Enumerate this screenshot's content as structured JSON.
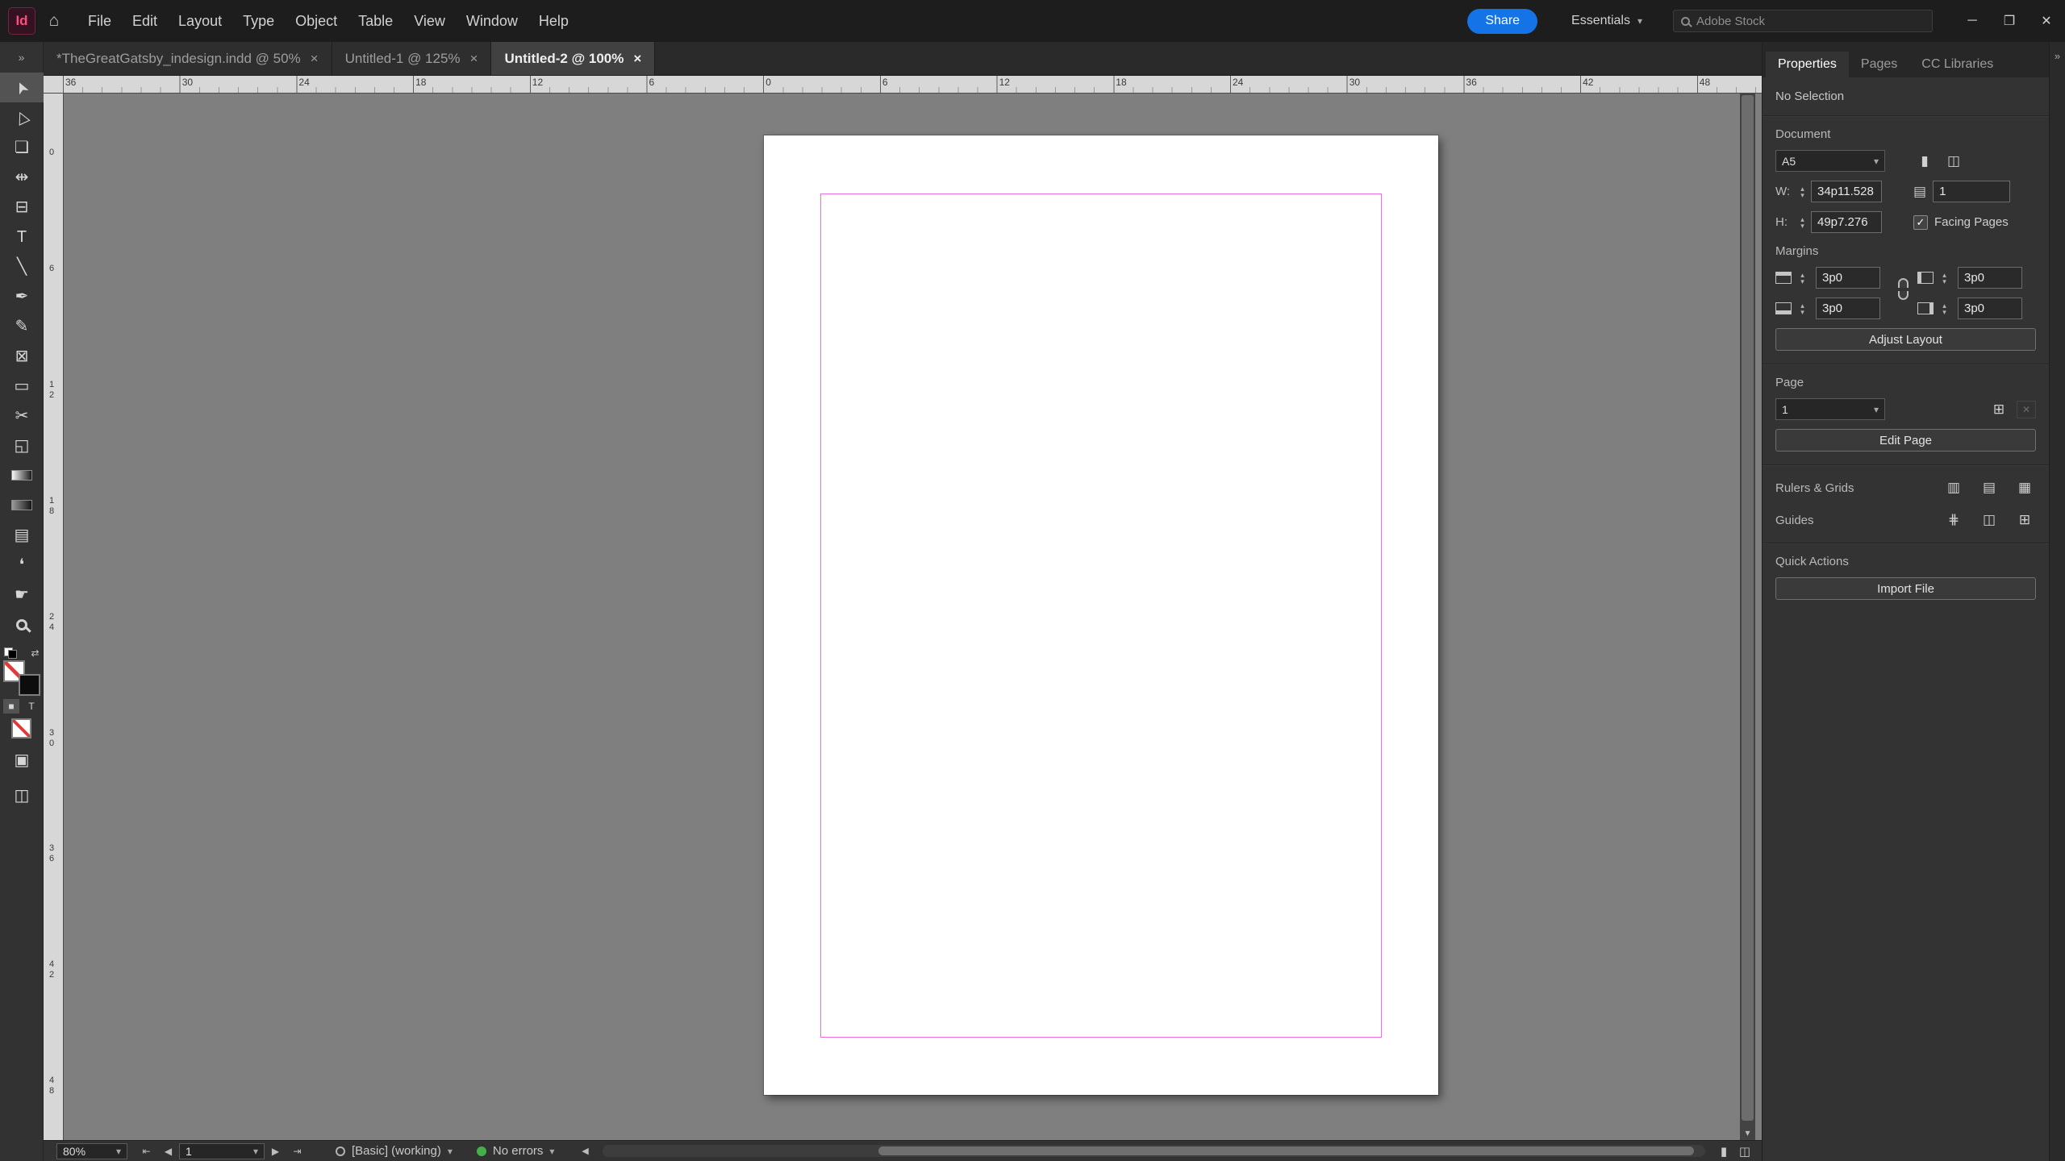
{
  "colors": {
    "accent_blue": "#1473e6",
    "margin_guide": "#ee6be9",
    "no_errors_green": "#44b04a",
    "logo_pink": "#ff4c7f",
    "canvas_gray": "#7f7f7f"
  },
  "ui": {
    "icons": {
      "home": "⌂",
      "collapse_left": "»",
      "collapse_right": "»",
      "chevron_down": "▾",
      "chevron_up": "▴",
      "close": "×",
      "minimize": "─",
      "restore": "❐",
      "close_window": "✕",
      "nav_first": "⇤",
      "nav_prev": "◀",
      "nav_next": "▶",
      "nav_last": "⇥",
      "swap": "⇄",
      "fmt_container": "■",
      "fmt_text": "T",
      "view_normal": "▣",
      "screen_mode": "◫",
      "doc_portrait": "▮",
      "doc_landscape": "◫",
      "pages_book": "▤",
      "add_page": "⊞",
      "delete_page": "✕",
      "ruler_icon": "▥",
      "baseline_grid_icon": "▤",
      "document_grid_icon": "▦",
      "guides_icon": "⋕",
      "column_guides_icon": "◫",
      "smart_guides_icon": "⊞",
      "check": "✓"
    }
  },
  "titlebar": {
    "logo": "Id",
    "menus": [
      "File",
      "Edit",
      "Layout",
      "Type",
      "Object",
      "Table",
      "View",
      "Window",
      "Help"
    ],
    "share_label": "Share",
    "workspace_label": "Essentials",
    "stock_placeholder": "Adobe Stock"
  },
  "tabs": [
    {
      "label": "*TheGreatGatsby_indesign.indd @ 50%"
    },
    {
      "label": "Untitled-1 @ 125%"
    },
    {
      "label": "Untitled-2 @ 100%",
      "active": true
    }
  ],
  "rulers": {
    "horizontal": [
      "36",
      "30",
      "24",
      "18",
      "12",
      "6",
      "0",
      "6",
      "12",
      "18",
      "24",
      "30",
      "36",
      "42",
      "48"
    ],
    "vertical": [
      "0",
      "6",
      "12",
      "18",
      "24",
      "30",
      "36",
      "42",
      "48"
    ]
  },
  "toolbar": {
    "tools": [
      {
        "name": "selection-tool",
        "glyph": "➤",
        "selected": true,
        "cls": "rot"
      },
      {
        "name": "direct-selection-tool",
        "glyph": "▷",
        "cls": "rot"
      },
      {
        "name": "page-tool",
        "glyph": "❏"
      },
      {
        "name": "gap-tool",
        "glyph": "⇹"
      },
      {
        "name": "content-collector-tool",
        "glyph": "⊟"
      },
      {
        "name": "type-tool",
        "glyph": "T"
      },
      {
        "name": "line-tool",
        "glyph": "╲"
      },
      {
        "name": "pen-tool",
        "glyph": "✒"
      },
      {
        "name": "pencil-tool",
        "glyph": "✎"
      },
      {
        "name": "rectangle-frame-tool",
        "glyph": "⊠"
      },
      {
        "name": "rectangle-tool",
        "glyph": "▭"
      },
      {
        "name": "scissors-tool",
        "glyph": "✂"
      },
      {
        "name": "free-transform-tool",
        "glyph": "◱"
      },
      {
        "name": "gradient-swatch-tool",
        "kind": "gradient"
      },
      {
        "name": "gradient-feather-tool",
        "kind": "gradient2"
      },
      {
        "name": "note-tool",
        "glyph": "▤"
      },
      {
        "name": "eyedropper-tool",
        "glyph": "❛"
      },
      {
        "name": "hand-tool",
        "glyph": "☛"
      },
      {
        "name": "zoom-tool",
        "kind": "lens"
      }
    ]
  },
  "properties_panel": {
    "tabs": [
      {
        "label": "Properties",
        "active": true
      },
      {
        "label": "Pages"
      },
      {
        "label": "CC Libraries"
      }
    ],
    "selection_status": "No Selection",
    "document": {
      "section_label": "Document",
      "preset": "A5",
      "w_label": "W:",
      "w_value": "34p11.528",
      "h_label": "H:",
      "h_value": "49p7.276",
      "pages_value": "1",
      "facing_pages_label": "Facing Pages",
      "facing_pages_checked": true
    },
    "margins": {
      "section_label": "Margins",
      "top": "3p0",
      "bottom": "3p0",
      "inside": "3p0",
      "outside": "3p0",
      "adjust_layout_label": "Adjust Layout"
    },
    "page": {
      "section_label": "Page",
      "current": "1",
      "edit_page_label": "Edit Page"
    },
    "rulers_grids_label": "Rulers & Grids",
    "guides_label": "Guides",
    "quick_actions_label": "Quick Actions",
    "import_file_label": "Import File"
  },
  "statusbar": {
    "zoom": "80%",
    "page_field": "1",
    "preflight_profile": "[Basic] (working)",
    "errors_status": "No errors"
  }
}
